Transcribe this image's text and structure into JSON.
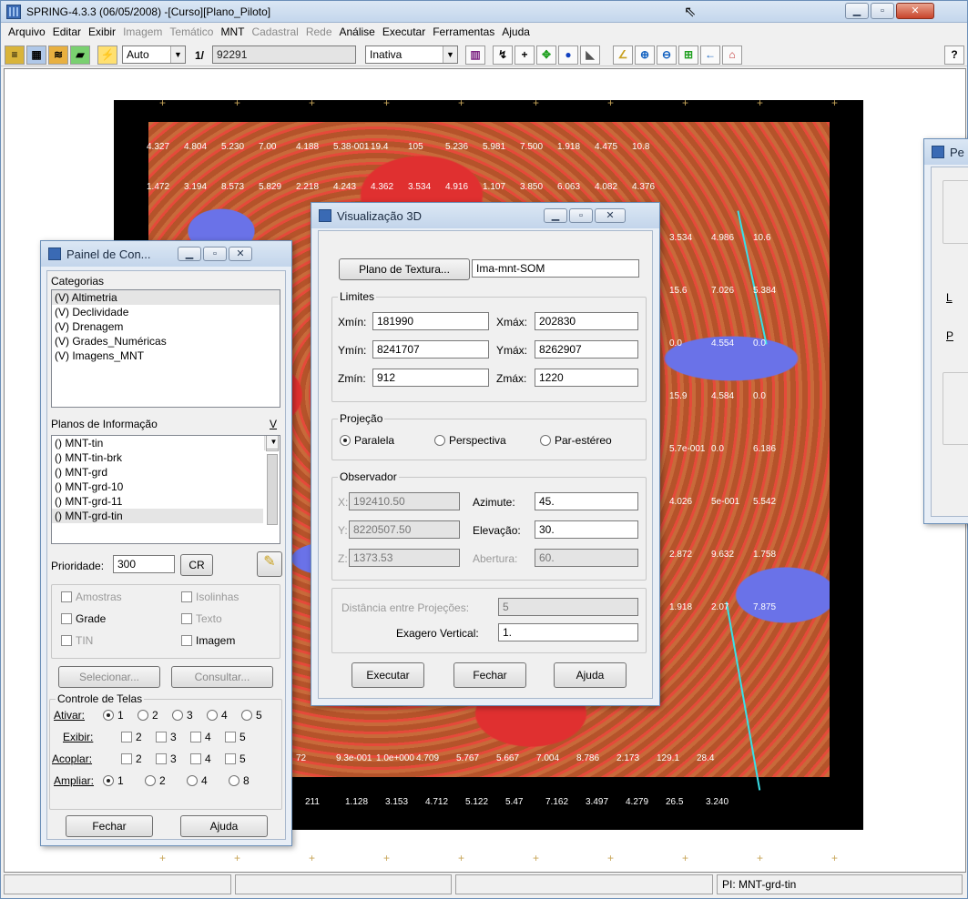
{
  "app": {
    "title": "SPRING-4.3.3 (06/05/2008) -[Curso][Plano_Piloto]"
  },
  "menu": [
    {
      "label": "Arquivo",
      "disabled": false
    },
    {
      "label": "Editar",
      "disabled": false
    },
    {
      "label": "Exibir",
      "disabled": false
    },
    {
      "label": "Imagem",
      "disabled": true
    },
    {
      "label": "Temático",
      "disabled": true
    },
    {
      "label": "MNT",
      "disabled": false
    },
    {
      "label": "Cadastral",
      "disabled": true
    },
    {
      "label": "Rede",
      "disabled": true
    },
    {
      "label": "Análise",
      "disabled": false
    },
    {
      "label": "Executar",
      "disabled": false
    },
    {
      "label": "Ferramentas",
      "disabled": false
    },
    {
      "label": "Ajuda",
      "disabled": false
    }
  ],
  "toolbar": {
    "zoom_mode": "Auto",
    "scale_prefix": "1/",
    "scale_value": "92291",
    "cursor_mode": "Inativa"
  },
  "map": {
    "labels_row1": [
      "4.327",
      "4.804",
      "5.230",
      "7.00",
      "4.188",
      "5.38-001",
      "19.4",
      "105",
      "5.236",
      "5.981",
      "7.500",
      "1.918",
      "4.475",
      "10.8"
    ],
    "labels_row2": [
      "1.472",
      "3.194",
      "8.573",
      "5.829",
      "2.218",
      "4.243",
      "4.362",
      "3.534",
      "4.916",
      "1.107",
      "3.850",
      "6.063",
      "4.082",
      "4.376"
    ],
    "labels_right": [
      "3.534",
      "4.986",
      "10.6",
      "15.6",
      "7.026",
      "5.384",
      "0.0",
      "4.554",
      "0.0",
      "15.9",
      "4.584",
      "0.0",
      "5.7e-001",
      "0.0",
      "6.186",
      "4.026",
      "5e-001",
      "5.542",
      "2.872",
      "9.632",
      "1.758",
      "1.918",
      "2.07",
      "7.875"
    ],
    "labels_bottom1": [
      "72",
      "9.3e-001",
      "1.0e+000",
      "4.709",
      "5.767",
      "5.667",
      "7.004",
      "8.786",
      "2.173",
      "129.1",
      "28.4"
    ],
    "labels_bottom2": [
      "211",
      "1.128",
      "3.153",
      "4.712",
      "5.122",
      "5.47",
      "7.162",
      "3.497",
      "4.279",
      "26.5",
      "3.240"
    ]
  },
  "status": {
    "cells": [
      "",
      "",
      "",
      "PI: MNT-grd-tin"
    ]
  },
  "painel": {
    "title": "Painel de Con...",
    "categorias_label": "Categorias",
    "categorias": [
      "(V) Altimetria",
      "(V) Declividade",
      "(V) Drenagem",
      "(V) Grades_Numéricas",
      "(V) Imagens_MNT"
    ],
    "planos_label": "Planos de Informação",
    "planos_v": "V",
    "planos": [
      "() MNT-tin",
      "() MNT-tin-brk",
      "() MNT-grd",
      "() MNT-grd-10",
      "() MNT-grd-11",
      "() MNT-grd-tin"
    ],
    "prioridade_label": "Prioridade:",
    "prioridade_value": "300",
    "cr_label": "CR",
    "chk": {
      "amostras": "Amostras",
      "isolinhas": "Isolinhas",
      "grade": "Grade",
      "texto": "Texto",
      "tin": "TIN",
      "imagem": "Imagem"
    },
    "selecionar": "Selecionar...",
    "consultar": "Consultar...",
    "controle_label": "Controle de Telas",
    "ativar": "Ativar:",
    "exibir": "Exibir:",
    "acoplar": "Acoplar:",
    "ampliar": "Ampliar:",
    "nums": [
      "1",
      "2",
      "3",
      "4",
      "5"
    ],
    "amp_nums": [
      "1",
      "2",
      "4",
      "8"
    ],
    "fechar": "Fechar",
    "ajuda": "Ajuda"
  },
  "vis3d": {
    "title": "Visualização 3D",
    "plano_btn": "Plano de Textura...",
    "plano_value": "Ima-mnt-SOM",
    "limites": "Limites",
    "xmin_l": "Xmín:",
    "xmin": "181990",
    "xmax_l": "Xmáx:",
    "xmax": "202830",
    "ymin_l": "Ymín:",
    "ymin": "8241707",
    "ymax_l": "Ymáx:",
    "ymax": "8262907",
    "zmin_l": "Zmín:",
    "zmin": "912",
    "zmax_l": "Zmáx:",
    "zmax": "1220",
    "projecao": "Projeção",
    "paralela": "Paralela",
    "perspectiva": "Perspectiva",
    "parestereo": "Par-estéreo",
    "observador": "Observador",
    "x_l": "X:",
    "x": "192410.50",
    "azimute_l": "Azimute:",
    "azimute": "45.",
    "y_l": "Y:",
    "y": "8220507.50",
    "elevacao_l": "Elevação:",
    "elevacao": "30.",
    "z_l": "Z:",
    "z": "1373.53",
    "abertura_l": "Abertura:",
    "abertura": "60.",
    "distancia_l": "Distância entre Projeções:",
    "distancia": "5",
    "exagero_l": "Exagero Vertical:",
    "exagero": "1.",
    "executar": "Executar",
    "fechar": "Fechar",
    "ajuda": "Ajuda"
  },
  "right_dlg": {
    "title": "Pe",
    "l1": "L",
    "l2": "P"
  }
}
